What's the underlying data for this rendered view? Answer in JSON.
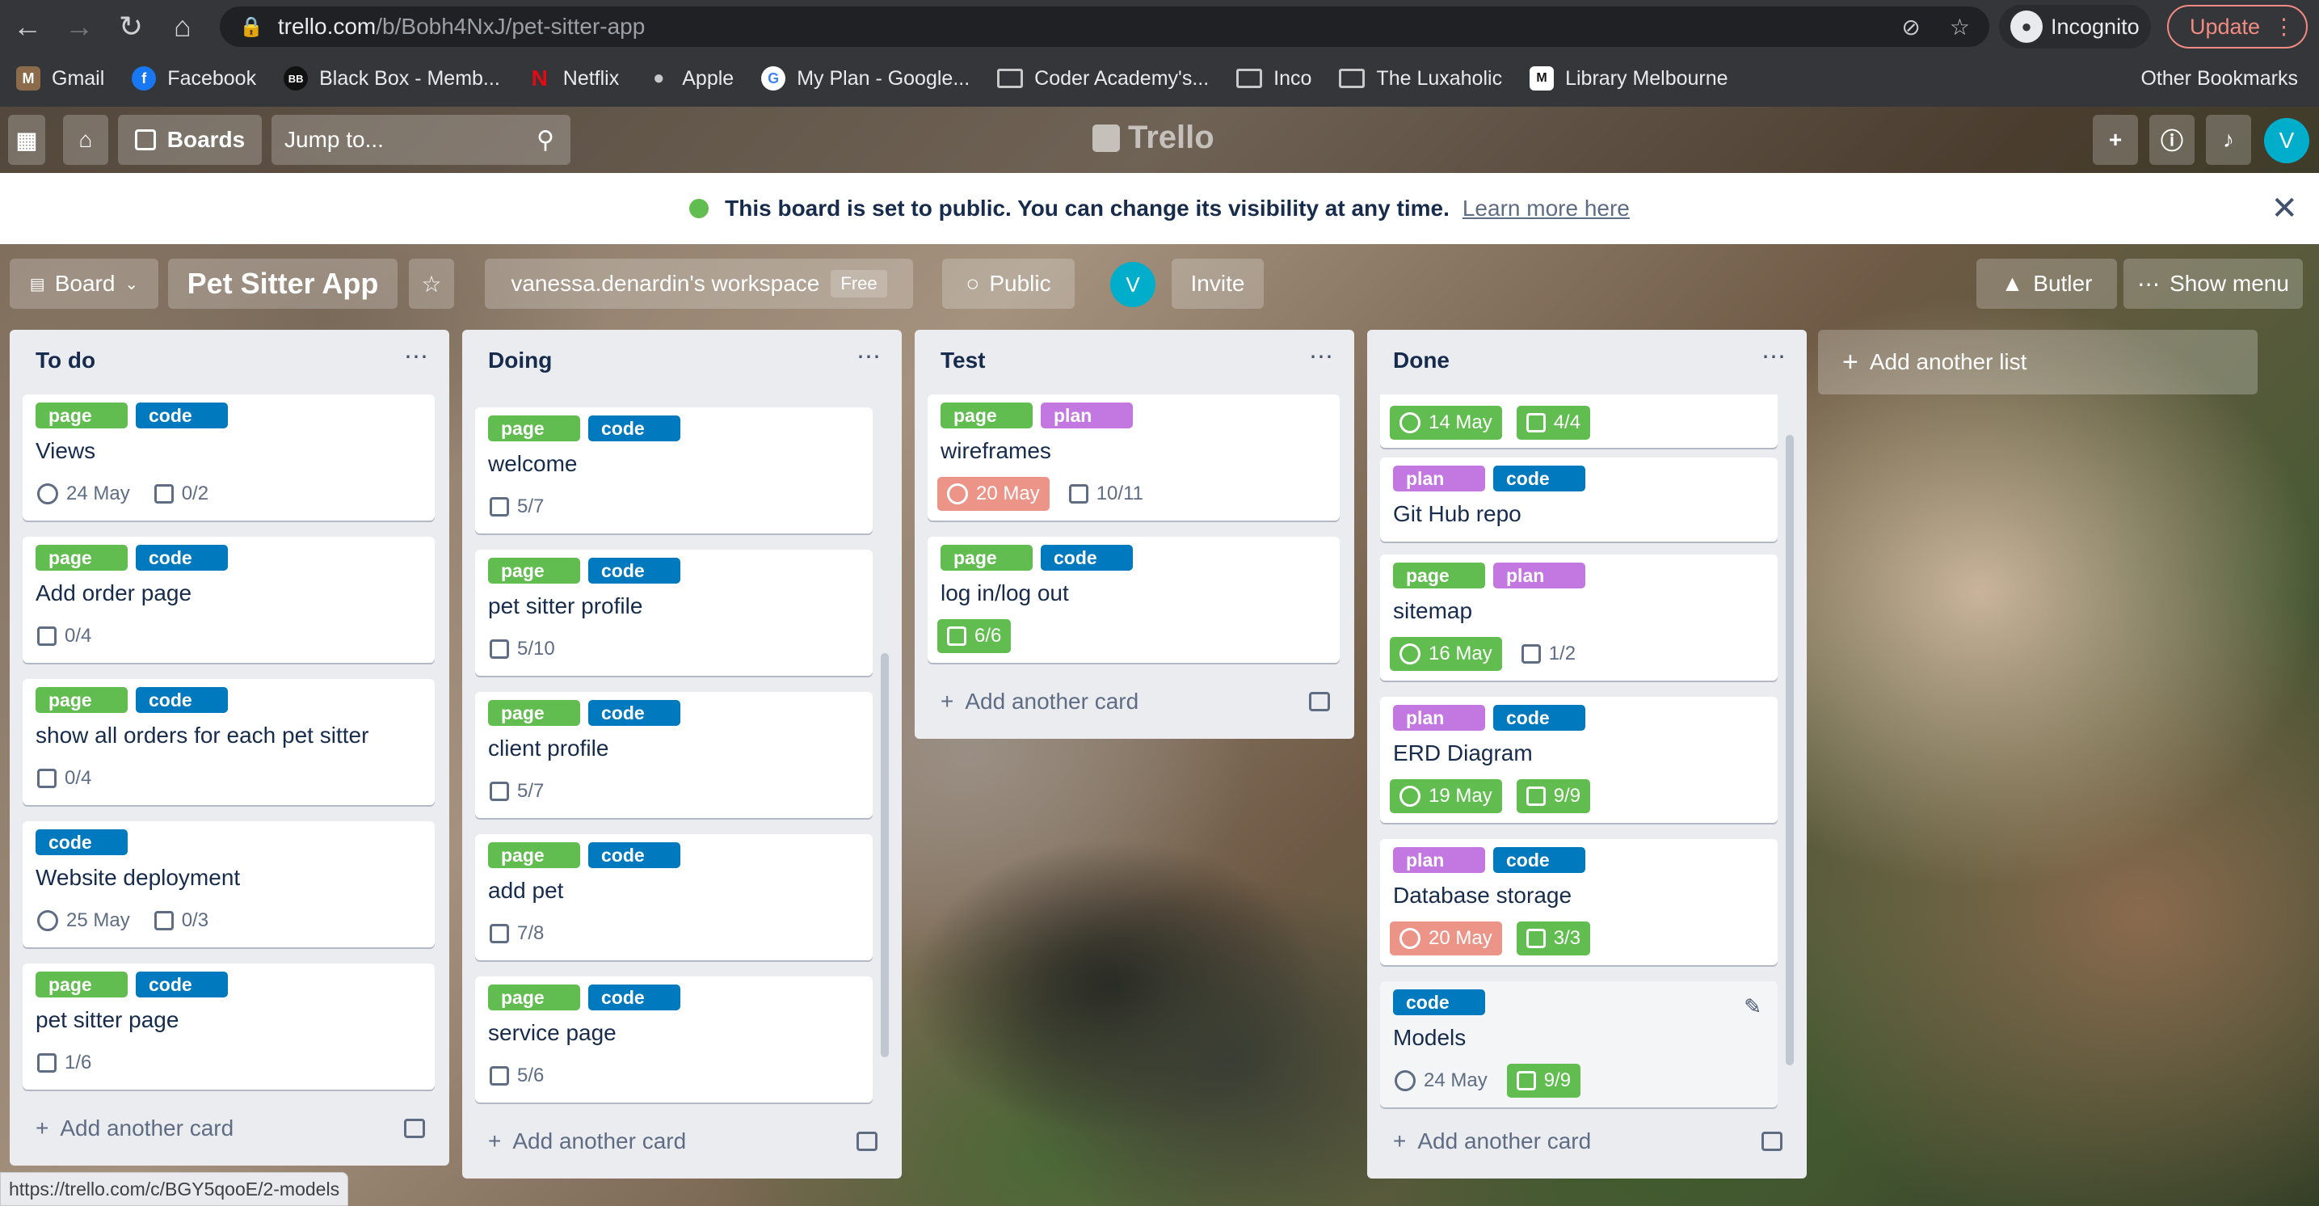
{
  "browser": {
    "url_host": "trello.com",
    "url_path": "/b/Bobh4NxJ/pet-sitter-app",
    "incognito_label": "Incognito",
    "update_label": "Update",
    "bookmarks": [
      "Gmail",
      "Facebook",
      "Black Box - Memb...",
      "Netflix",
      "Apple",
      "My Plan - Google...",
      "Coder Academy's...",
      "Inco",
      "The Luxaholic",
      "Library Melbourne"
    ],
    "other_bookmarks": "Other Bookmarks",
    "status_url": "https://trello.com/c/BGY5qooE/2-models"
  },
  "header": {
    "boards_label": "Boards",
    "search_placeholder": "Jump to...",
    "logo": "Trello",
    "avatar_initial": "V"
  },
  "notice": {
    "text": "This board is set to public. You can change its visibility at any time.",
    "link": "Learn more here"
  },
  "board": {
    "view_label": "Board",
    "title": "Pet Sitter App",
    "workspace": "vanessa.denardin's workspace",
    "workspace_badge": "Free",
    "visibility": "Public",
    "member_initial": "V",
    "invite_label": "Invite",
    "butler_label": "Butler",
    "menu_label": "Show menu",
    "add_list_label": "Add another list",
    "add_card_label": "Add another card"
  },
  "lists": [
    {
      "name": "To do",
      "cards": [
        {
          "labels": [
            "page",
            "code"
          ],
          "title": "Views",
          "due": "24 May",
          "check": "0/2"
        },
        {
          "labels": [
            "page",
            "code"
          ],
          "title": "Add order page",
          "check": "0/4"
        },
        {
          "labels": [
            "page",
            "code"
          ],
          "title": "show all orders for each pet sitter",
          "check": "0/4"
        },
        {
          "labels": [
            "code"
          ],
          "title": "Website deployment",
          "due": "25 May",
          "check": "0/3"
        },
        {
          "labels": [
            "page",
            "code"
          ],
          "title": "pet sitter page",
          "check": "1/6"
        }
      ]
    },
    {
      "name": "Doing",
      "cards": [
        {
          "labels": [
            "page",
            "code"
          ],
          "title": "welcome",
          "check": "5/7"
        },
        {
          "labels": [
            "page",
            "code"
          ],
          "title": "pet sitter profile",
          "check": "5/10"
        },
        {
          "labels": [
            "page",
            "code"
          ],
          "title": "client profile",
          "check": "5/7"
        },
        {
          "labels": [
            "page",
            "code"
          ],
          "title": "add pet",
          "check": "7/8"
        },
        {
          "labels": [
            "page",
            "code"
          ],
          "title": "service page",
          "check": "5/6"
        }
      ]
    },
    {
      "name": "Test",
      "cards": [
        {
          "labels": [
            "page",
            "plan"
          ],
          "title": "wireframes",
          "due": "20 May",
          "check": "10/11"
        },
        {
          "labels": [
            "page",
            "code"
          ],
          "title": "log in/log out",
          "check": "6/6"
        }
      ]
    },
    {
      "name": "Done",
      "cards": [
        {
          "due": "14 May",
          "check": "4/4"
        },
        {
          "labels": [
            "plan",
            "code"
          ],
          "title": "Git Hub repo"
        },
        {
          "labels": [
            "page",
            "plan"
          ],
          "title": "sitemap",
          "due": "16 May",
          "check": "1/2"
        },
        {
          "labels": [
            "plan",
            "code"
          ],
          "title": "ERD Diagram",
          "due": "19 May",
          "check": "9/9"
        },
        {
          "labels": [
            "plan",
            "code"
          ],
          "title": "Database storage",
          "due": "20 May",
          "check": "3/3"
        },
        {
          "labels": [
            "code"
          ],
          "title": "Models",
          "due": "24 May",
          "check": "9/9"
        }
      ]
    }
  ],
  "colors": {
    "page": "#61bd4f",
    "code": "#0079bf",
    "plan": "#c377e0",
    "overdue": "#ec9488"
  }
}
